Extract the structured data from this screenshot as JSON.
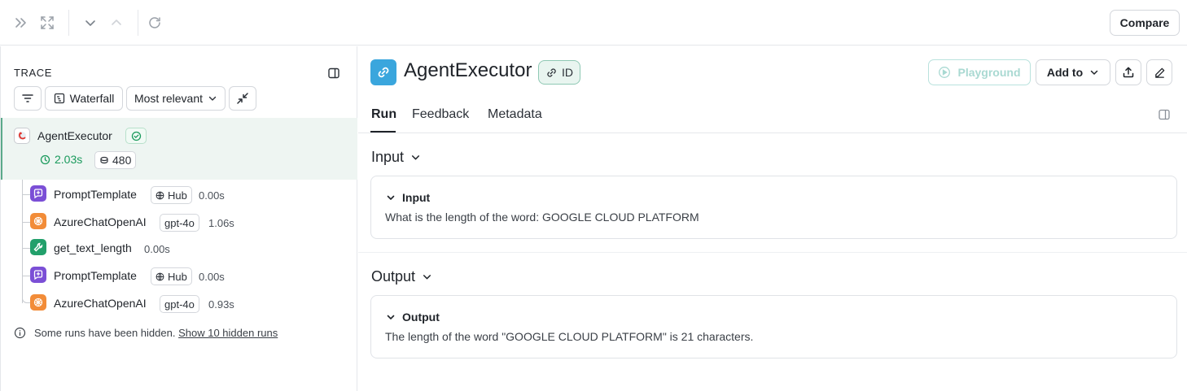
{
  "toolbar": {
    "compare_label": "Compare",
    "icons": [
      "expand-panel-icon",
      "fullscreen-icon",
      "chevron-down-icon",
      "chevron-up-icon",
      "refresh-icon"
    ]
  },
  "trace_panel": {
    "title": "TRACE",
    "view_mode_label": "Waterfall",
    "sort_label": "Most relevant",
    "root": {
      "name": "AgentExecutor",
      "duration": "2.03s",
      "tokens": "480",
      "status": "success"
    },
    "children": [
      {
        "name": "PromptTemplate",
        "tag": "Hub",
        "duration": "0.00s",
        "kind": "prompt"
      },
      {
        "name": "AzureChatOpenAI",
        "tag": "gpt-4o",
        "duration": "1.06s",
        "kind": "llm"
      },
      {
        "name": "get_text_length",
        "tag": "",
        "duration": "0.00s",
        "kind": "tool"
      },
      {
        "name": "PromptTemplate",
        "tag": "Hub",
        "duration": "0.00s",
        "kind": "prompt"
      },
      {
        "name": "AzureChatOpenAI",
        "tag": "gpt-4o",
        "duration": "0.93s",
        "kind": "llm"
      }
    ],
    "hidden_notice": "Some runs have been hidden.",
    "hidden_link": "Show 10 hidden runs"
  },
  "run_panel": {
    "title": "AgentExecutor",
    "id_label": "ID",
    "playground_label": "Playground",
    "add_to_label": "Add to",
    "tabs": [
      {
        "label": "Run",
        "active": true
      },
      {
        "label": "Feedback",
        "active": false
      },
      {
        "label": "Metadata",
        "active": false
      }
    ],
    "input": {
      "section_label": "Input",
      "card_title": "Input",
      "value": "What is the length of the word: GOOGLE CLOUD PLATFORM"
    },
    "output": {
      "section_label": "Output",
      "card_title": "Output",
      "value": "The length of the word \"GOOGLE CLOUD PLATFORM\" is 21 characters."
    }
  },
  "colors": {
    "success": "#1a9a5c",
    "prompt_purple": "#7b4fd6",
    "llm_orange": "#f28c38",
    "tool_green": "#22a06b",
    "chain_blue": "#3aa6dd",
    "accent_teal": "#5aa98a"
  }
}
